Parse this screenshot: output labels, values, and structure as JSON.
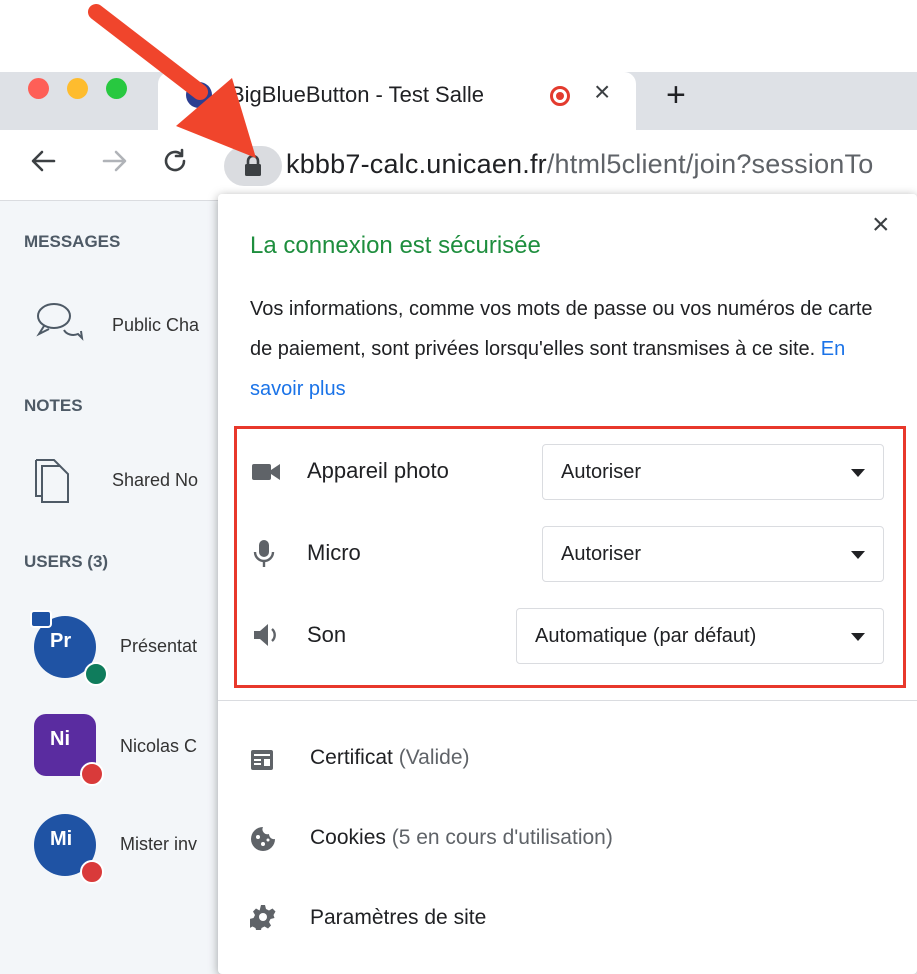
{
  "browser": {
    "tab": {
      "title": "BigBlueButton - Test Salle",
      "close_glyph": "×"
    },
    "new_tab_glyph": "+",
    "url": {
      "host": "kbbb7-calc.unicaen.fr",
      "path": "/html5client/join?sessionTo"
    },
    "icons": {
      "back": "arrow-left-icon",
      "forward": "arrow-right-icon",
      "reload": "reload-icon",
      "lock": "lock-icon"
    }
  },
  "sidebar": {
    "messages_heading": "MESSAGES",
    "public_chat": "Public Cha",
    "notes_heading": "NOTES",
    "shared_notes": "Shared No",
    "users_heading": "USERS (3)",
    "users": [
      {
        "initials": "Pr",
        "name": "Présentat"
      },
      {
        "initials": "Ni",
        "name": "Nicolas C"
      },
      {
        "initials": "Mi",
        "name": "Mister inv"
      }
    ]
  },
  "popup": {
    "close_glyph": "×",
    "title": "La connexion est sécurisée",
    "description": "Vos informations, comme vos mots de passe ou vos numéros de carte de paiement, sont privées lorsqu'elles sont transmises à ce site.",
    "learn_more": "En savoir plus",
    "permissions": [
      {
        "label": "Appareil photo",
        "value": "Autoriser",
        "icon": "camera-icon"
      },
      {
        "label": "Micro",
        "value": "Autoriser",
        "icon": "microphone-icon"
      },
      {
        "label": "Son",
        "value": "Automatique (par défaut)",
        "icon": "speaker-icon"
      }
    ],
    "links": [
      {
        "label": "Certificat",
        "detail": "(Valide)",
        "icon": "certificate-icon"
      },
      {
        "label": "Cookies",
        "detail": "(5 en cours d'utilisation)",
        "icon": "cookie-icon"
      },
      {
        "label": "Paramètres de site",
        "detail": "",
        "icon": "gear-icon"
      }
    ]
  },
  "colors": {
    "secure_green": "#1e8e3e",
    "link_blue": "#1a73e8",
    "highlight_red": "#e8382b",
    "arrow_red": "#f0452c"
  }
}
